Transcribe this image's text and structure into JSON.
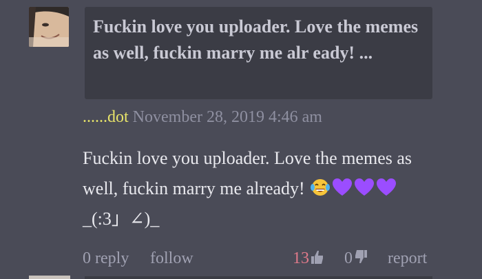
{
  "comment": {
    "quote": "Fuckin love you uploader. Love the memes as well, fuckin marry me alr eady! ...",
    "author": "......dot",
    "timestamp": "November 28, 2019 4:46 am",
    "body_text": "Fuckin love you uploader. Love the memes as well, fuckin marry me already!",
    "kaomoji": "_(:3」∠)_",
    "emojis": [
      "laughing-crying-icon",
      "purple-heart-icon",
      "purple-heart-icon",
      "purple-heart-icon"
    ],
    "actions": {
      "reply": "0 reply",
      "follow": "follow",
      "like_count": "13",
      "dislike_count": "0",
      "report": "report"
    }
  },
  "colors": {
    "background": "#4a4b57",
    "quote_bg": "#3b3c45",
    "author": "#e8e46a",
    "like_count": "#e07a8a",
    "heart": "#9b4dff"
  }
}
